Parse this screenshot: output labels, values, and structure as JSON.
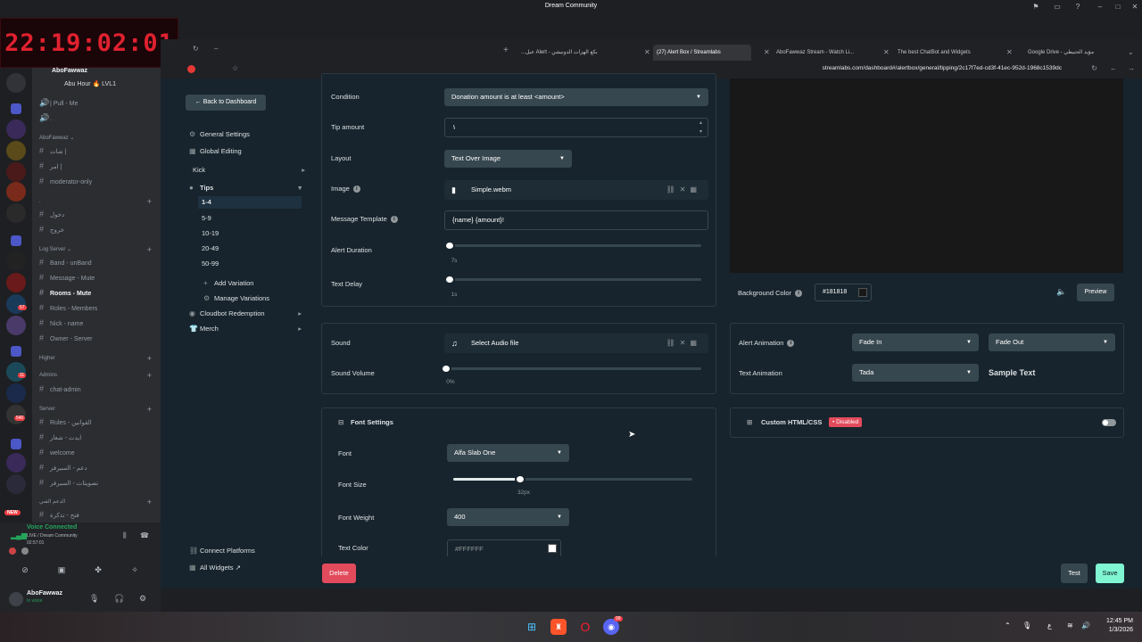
{
  "window": {
    "title": "Dream Community"
  },
  "clock": {
    "time": "22:19:02:01"
  },
  "discord": {
    "channels": [
      {
        "kind": "voice-user",
        "label": "AboFawwaz"
      },
      {
        "kind": "voice-user",
        "label": "Abu Hour 🔥 LVL1"
      },
      {
        "kind": "voice",
        "label": "| Pull - Me"
      },
      {
        "kind": "voice",
        "label": "."
      },
      {
        "kind": "cat",
        "label": "AboFawwaz"
      },
      {
        "kind": "text",
        "label": "شات |"
      },
      {
        "kind": "text",
        "label": "امر |"
      },
      {
        "kind": "text",
        "label": "moderator-only"
      },
      {
        "kind": "cat",
        "label": "."
      },
      {
        "kind": "text",
        "label": "دخول"
      },
      {
        "kind": "text",
        "label": "خروج"
      },
      {
        "kind": "cat",
        "label": "Log Server"
      },
      {
        "kind": "text",
        "label": "Band - unBand"
      },
      {
        "kind": "text",
        "label": "Message - Mute"
      },
      {
        "kind": "text",
        "label": "Rooms - Mute",
        "active": true
      },
      {
        "kind": "text",
        "label": "Roles - Members"
      },
      {
        "kind": "text",
        "label": "Nick - name"
      },
      {
        "kind": "text",
        "label": "Owner - Server"
      },
      {
        "kind": "cat",
        "label": "Higher"
      },
      {
        "kind": "cat",
        "label": "Admins"
      },
      {
        "kind": "text",
        "label": "chat-admin"
      },
      {
        "kind": "cat",
        "label": "Server"
      },
      {
        "kind": "text",
        "label": "Rules - القوانين"
      },
      {
        "kind": "text",
        "label": "ايدت - شعار"
      },
      {
        "kind": "text",
        "label": "welcome"
      },
      {
        "kind": "text",
        "label": "دعم - السيرفر"
      },
      {
        "kind": "text",
        "label": "تصويتات - السيرفر"
      },
      {
        "kind": "cat",
        "label": "الدعم الفني"
      },
      {
        "kind": "text",
        "label": "فتح - تذكرة"
      }
    ],
    "guild_badges": [
      "57",
      "11",
      "540"
    ],
    "new_badge": "NEW",
    "voice": {
      "status": "Voice Connected",
      "server": "LIVE / Dream Community",
      "timer": "02:57:01"
    },
    "user": {
      "name": "AboFawwaz",
      "status": "In voice"
    }
  },
  "browser": {
    "tabs": [
      {
        "label": "...عيل Alert - بكع الهزات الدونيشن",
        "active": false
      },
      {
        "label": "(27) Alert Box / Streamlabs",
        "active": true
      },
      {
        "label": "AboFawwaz Stream - Watch Li...",
        "active": false
      },
      {
        "label": "The best ChatBot and Widgets",
        "active": false
      },
      {
        "label": "Google Drive - مؤيد الحنيطي",
        "active": false
      }
    ],
    "url": "streamlabs.com/dashboard#/alertbox/general/tipping/2c17f7ed-cd3f-41ec-952d-1968c1539dc"
  },
  "sidebar": {
    "back": "Back to Dashboard",
    "general": "General Settings",
    "global": "Global Editing",
    "kick": "Kick",
    "tips": "Tips",
    "variations": [
      "1-4",
      "5-9",
      "10-19",
      "20-49",
      "50-99"
    ],
    "add_variation": "Add Variation",
    "manage_variations": "Manage Variations",
    "cloudbot": "Cloudbot Redemption",
    "merch": "Merch",
    "connect": "Connect Platforms",
    "all_widgets": "All Widgets"
  },
  "form": {
    "condition_label": "Condition",
    "condition_value": "Donation amount is at least <amount>",
    "tip_label": "Tip amount",
    "tip_value": "١",
    "layout_label": "Layout",
    "layout_value": "Text Over Image",
    "image_label": "Image",
    "image_value": "Simple.webm",
    "template_label": "Message Template",
    "template_value": "{name}  {amount}!",
    "duration_label": "Alert Duration",
    "duration_value": "7s",
    "delay_label": "Text Delay",
    "delay_value": "1s",
    "sound_label": "Sound",
    "sound_value": "Select Audio file",
    "volume_label": "Sound Volume",
    "volume_value": "0%",
    "font_settings": "Font Settings",
    "font_label": "Font",
    "font_value": "Alfa Slab One",
    "size_label": "Font Size",
    "size_value": "32px",
    "weight_label": "Font Weight",
    "weight_value": "400",
    "color_label": "Text Color",
    "color_value": "#FFFFFF"
  },
  "sliders": {
    "duration": 0.0,
    "delay": 0.0,
    "volume": 0.0,
    "font_size": 0.28
  },
  "right": {
    "bg_label": "Background Color",
    "bg_value": "#181818",
    "preview": "Preview",
    "alert_anim_label": "Alert Animation",
    "anim_in": "Fade In",
    "anim_out": "Fade Out",
    "text_anim_label": "Text Animation",
    "text_anim": "Tada",
    "sample": "Sample Text",
    "custom_label": "Custom HTML/CSS",
    "custom_badge": "• Disabled"
  },
  "footer": {
    "delete": "Delete",
    "test": "Test",
    "save": "Save"
  },
  "taskbar": {
    "lang": "ع",
    "time": "12:45 PM",
    "date": "1/3/2026",
    "discord_badge": "99"
  },
  "colors": {
    "accent": "#80f5d2",
    "delete": "#e24b5c",
    "preview_bg": "#181818"
  }
}
